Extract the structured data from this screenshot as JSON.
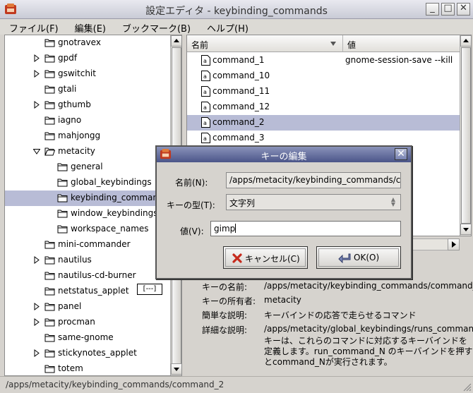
{
  "window": {
    "title": "設定エディタ - keybinding_commands"
  },
  "menubar": [
    {
      "label": "ファイル(F)"
    },
    {
      "label": "編集(E)"
    },
    {
      "label": "ブックマーク(B)"
    },
    {
      "label": "ヘルプ(H)"
    }
  ],
  "tree": [
    {
      "label": "gnotravex",
      "expander": "none",
      "indent": 0
    },
    {
      "label": "gpdf",
      "expander": "collapsed",
      "indent": 0
    },
    {
      "label": "gswitchit",
      "expander": "collapsed",
      "indent": 0
    },
    {
      "label": "gtali",
      "expander": "none",
      "indent": 0
    },
    {
      "label": "gthumb",
      "expander": "collapsed",
      "indent": 0
    },
    {
      "label": "iagno",
      "expander": "none",
      "indent": 0
    },
    {
      "label": "mahjongg",
      "expander": "none",
      "indent": 0
    },
    {
      "label": "metacity",
      "expander": "expanded",
      "indent": 0
    },
    {
      "label": "general",
      "expander": "none",
      "indent": 1
    },
    {
      "label": "global_keybindings",
      "expander": "none",
      "indent": 1
    },
    {
      "label": "keybinding_commands",
      "expander": "none",
      "indent": 1,
      "selected": true
    },
    {
      "label": "window_keybindings",
      "expander": "none",
      "indent": 1
    },
    {
      "label": "workspace_names",
      "expander": "none",
      "indent": 1
    },
    {
      "label": "mini-commander",
      "expander": "none",
      "indent": 0
    },
    {
      "label": "nautilus",
      "expander": "collapsed",
      "indent": 0
    },
    {
      "label": "nautilus-cd-burner",
      "expander": "none",
      "indent": 0
    },
    {
      "label": "netstatus_applet",
      "expander": "none",
      "indent": 0
    },
    {
      "label": "panel",
      "expander": "collapsed",
      "indent": 0
    },
    {
      "label": "procman",
      "expander": "collapsed",
      "indent": 0
    },
    {
      "label": "same-gnome",
      "expander": "none",
      "indent": 0
    },
    {
      "label": "stickynotes_applet",
      "expander": "collapsed",
      "indent": 0
    },
    {
      "label": "totem",
      "expander": "none",
      "indent": 0
    }
  ],
  "netstatus_widget": "[---]",
  "keylist": {
    "headers": {
      "name": "名前",
      "value": "値"
    },
    "rows": [
      {
        "name": "command_1",
        "value": "gnome-session-save --kill"
      },
      {
        "name": "command_10",
        "value": ""
      },
      {
        "name": "command_11",
        "value": ""
      },
      {
        "name": "command_12",
        "value": ""
      },
      {
        "name": "command_2",
        "value": "",
        "selected": true
      },
      {
        "name": "command_3",
        "value": ""
      }
    ]
  },
  "details": {
    "key_name_label": "キーの名前:",
    "key_name": "/apps/metacity/keybinding_commands/command_2",
    "owner_label": "キーの所有者:",
    "owner": "metacity",
    "short_label": "簡単な説明:",
    "short": "キーバインドの応答で走らせるコマンド",
    "long_label": "詳細な説明:",
    "long_lines": [
      "/apps/metacity/global_keybindings/runs_command_N",
      "キーは、これらのコマンドに対応するキーバインドを",
      "定義します。run_command_N のキーバインドを押す",
      "とcommand_Nが実行されます。"
    ]
  },
  "status": "/apps/metacity/keybinding_commands/command_2",
  "dialog": {
    "title": "キーの編集",
    "name_label": "名前(N):",
    "name_value": "/apps/metacity/keybinding_commands/comma",
    "type_label": "キーの型(T):",
    "type_value": "文字列",
    "value_label": "値(V):",
    "value_value": "gimp",
    "cancel_label": "キャンセル(C)",
    "ok_label": "OK(O)"
  },
  "colors": {
    "selection": "#b8bcd6",
    "dialog_title": "#4b5589",
    "cancel_icon": "#c62a1c"
  }
}
